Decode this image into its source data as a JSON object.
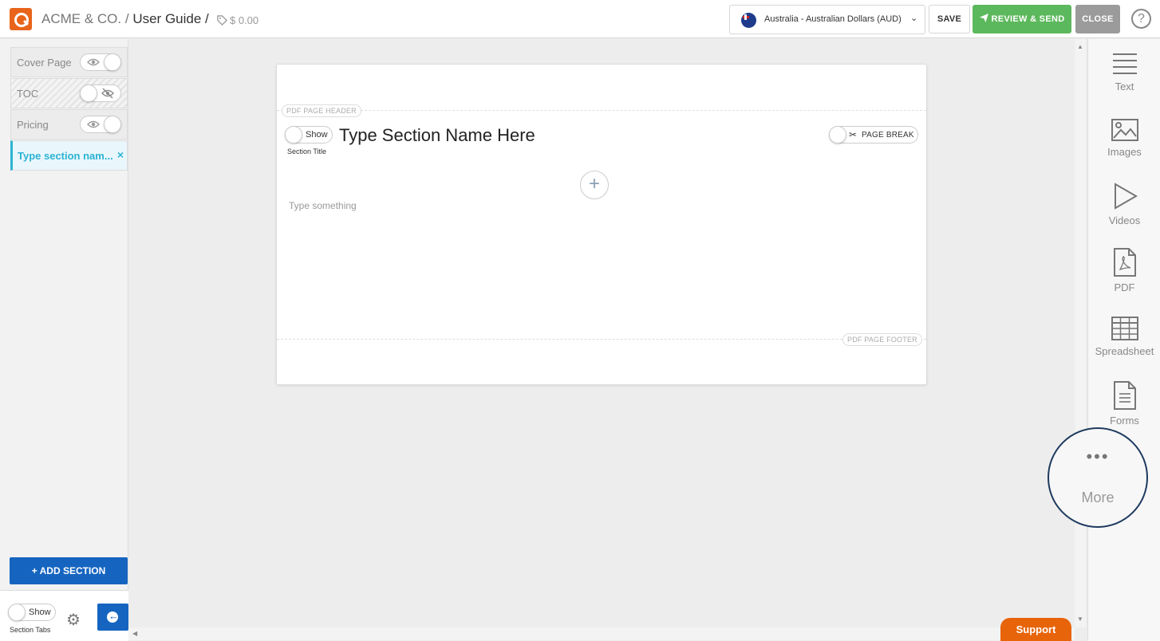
{
  "header": {
    "company": "ACME & CO.",
    "separator": "/",
    "doc_title": "User Guide /",
    "price": "$ 0.00",
    "currency": "Australia - Australian Dollars (AUD)",
    "save_label": "SAVE",
    "review_label": "REVIEW & SEND",
    "close_label": "CLOSE",
    "help_glyph": "?"
  },
  "sidebar": {
    "items": [
      {
        "label": "Cover Page",
        "visible": true
      },
      {
        "label": "TOC",
        "visible": false
      },
      {
        "label": "Pricing",
        "visible": true
      },
      {
        "label": "Type section nam...",
        "active": true
      }
    ],
    "close_glyph": "×",
    "add_section_label": "ADD SECTION",
    "show_label": "Show",
    "section_tabs_label": "Section Tabs"
  },
  "page": {
    "header_pill": "PDF PAGE HEADER",
    "footer_pill": "PDF PAGE FOOTER",
    "show_label": "Show",
    "section_title_label": "Section Title",
    "section_name": "Type Section Name Here",
    "page_break_label": "PAGE BREAK",
    "body_placeholder": "Type something"
  },
  "tools": [
    {
      "label": "Text",
      "icon": "text-icon"
    },
    {
      "label": "Images",
      "icon": "image-icon"
    },
    {
      "label": "Videos",
      "icon": "video-icon"
    },
    {
      "label": "PDF",
      "icon": "pdf-icon"
    },
    {
      "label": "Spreadsheet",
      "icon": "spreadsheet-icon"
    },
    {
      "label": "Forms",
      "icon": "forms-icon"
    }
  ],
  "more_label": "More",
  "support_label": "Support",
  "colors": {
    "brand": "#e8641b",
    "accent": "#2bb3d4",
    "primary_button": "#1565c0",
    "review_button": "#5cb85c",
    "close_button": "#9b9b9b",
    "support": "#e8640a",
    "more_ring": "#1e3a5f"
  }
}
